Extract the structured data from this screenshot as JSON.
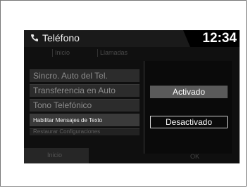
{
  "statusbar": {
    "title": "Teléfono",
    "clock": "12:34",
    "phone_icon": "phone-icon"
  },
  "tabs": [
    "Inicio",
    "Llamadas"
  ],
  "menu": {
    "items": [
      "Sincro. Auto del Tel.",
      "Transferencia en Auto",
      "Tono Telefónico",
      "Habilitar Mensajes de Texto",
      "Restaurar Configuraciones"
    ]
  },
  "popup": {
    "options": [
      "Activado",
      "Desactivado"
    ]
  },
  "bottom": {
    "left_label": "Inicio",
    "right_label": "OK"
  },
  "colors": {
    "screen_bg": "#0f0f0f",
    "highlight": "#5a5a5a"
  }
}
